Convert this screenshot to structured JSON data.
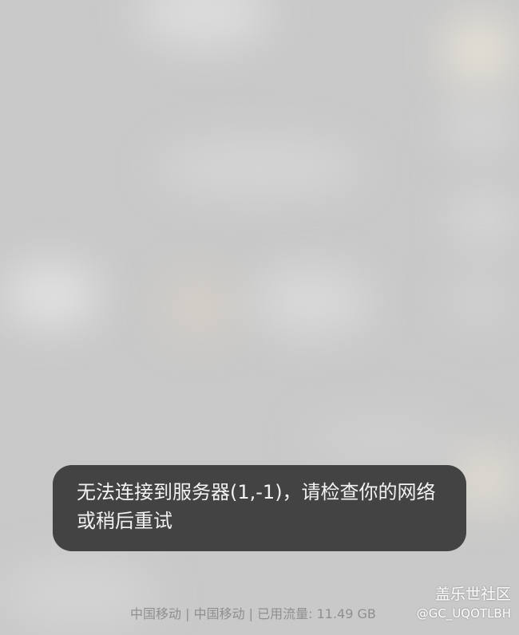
{
  "toast": {
    "message": "无法连接到服务器(1,-1)，请检查你的网络或稍后重试"
  },
  "status_bar": {
    "carrier_info": "中国移动 | 中国移动 | 已用流量: 11.49 GB"
  },
  "watermark": {
    "community": "盖乐世社区",
    "user_id": "@GC_UQOTLBH"
  },
  "colors": {
    "background": "#c9c9c9",
    "toast_bg": "#434343",
    "toast_text": "#f2f2f2",
    "status_text": "#8f8f8f"
  }
}
